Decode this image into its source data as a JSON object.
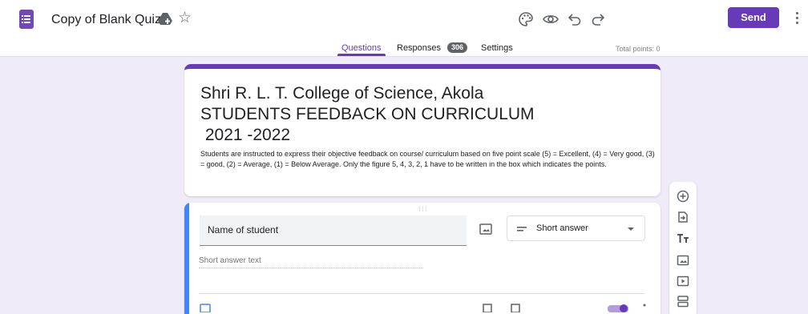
{
  "app": {
    "document_title": "Copy of Blank Quiz",
    "send_label": "Send"
  },
  "tabs": [
    {
      "label": "Questions",
      "active": true
    },
    {
      "label": "Responses",
      "badge": "306"
    },
    {
      "label": "Settings"
    }
  ],
  "total_points": "Total points: 0",
  "form": {
    "title_lines": [
      "Shri R. L. T. College of Science, Akola",
      "STUDENTS FEEDBACK ON CURRICULUM",
      " 2021 -2022"
    ],
    "description": "Students are instructed to express their objective feedback on course/ curriculum based on five point scale (5) = Excellent, (4) = Very good, (3) = good,  (2) = Average, (1) = Below Average. Only the figure 5, 4, 3, 2, 1 have to be written in the box which indicates the points."
  },
  "question": {
    "title": "Name of student",
    "type": "Short answer",
    "answer_placeholder": "Short answer text"
  },
  "icons": {
    "top_bar": [
      "forms-logo-icon",
      "move-to-drive-icon",
      "star-icon",
      "palette-icon",
      "preview-eye-icon",
      "undo-icon",
      "redo-icon",
      "more-vert-icon"
    ],
    "side_toolbar": [
      "add-question-icon",
      "import-questions-icon",
      "add-title-icon",
      "add-image-icon",
      "add-video-icon",
      "add-section-icon"
    ]
  },
  "colors": {
    "accent": "#673ab7",
    "background": "#f0ebf8",
    "question_accent": "#4285f4"
  }
}
